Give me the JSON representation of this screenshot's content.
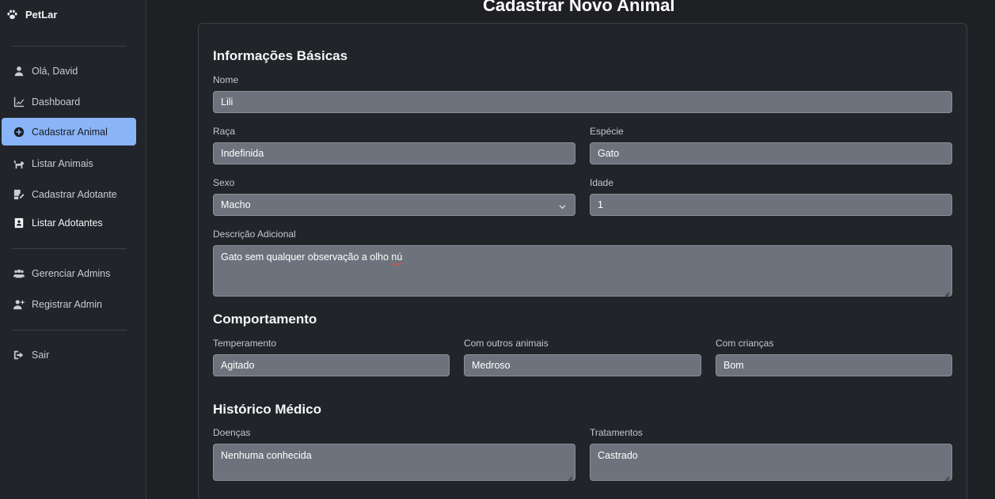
{
  "brand": {
    "name": "PetLar",
    "icon": "paw-icon"
  },
  "sidebar": {
    "items": [
      {
        "label": "Olá, David",
        "icon": "user-icon"
      },
      {
        "label": "Dashboard",
        "icon": "chart-line-icon"
      },
      {
        "label": "Cadastrar Animal",
        "icon": "plus-circle-icon",
        "active": true
      },
      {
        "label": "Listar Animais",
        "icon": "dog-icon"
      },
      {
        "label": "Cadastrar Adotante",
        "icon": "edit-user-icon"
      },
      {
        "label": "Listar Adotantes",
        "icon": "address-book-icon"
      },
      {
        "label": "Gerenciar Admins",
        "icon": "users-icon"
      },
      {
        "label": "Registrar Admin",
        "icon": "user-plus-icon"
      },
      {
        "label": "Sair",
        "icon": "sign-out-icon"
      }
    ]
  },
  "page": {
    "title": "Cadastrar Novo Animal"
  },
  "basic": {
    "title": "Informações Básicas",
    "name": {
      "label": "Nome",
      "value": "Lili"
    },
    "breed": {
      "label": "Raça",
      "value": "Indefinida"
    },
    "species": {
      "label": "Espécie",
      "value": "Gato"
    },
    "sex": {
      "label": "Sexo",
      "value": "Macho"
    },
    "age": {
      "label": "Idade",
      "value": "1"
    },
    "description": {
      "label": "Descrição Adicional",
      "value_main": "Gato sem qualquer observação a olho ",
      "value_flagged": "nú"
    }
  },
  "behavior": {
    "title": "Comportamento",
    "temperament": {
      "label": "Temperamento",
      "value": "Agitado"
    },
    "with_animals": {
      "label": "Com outros animais",
      "value": "Medroso"
    },
    "with_children": {
      "label": "Com crianças",
      "value": "Bom"
    }
  },
  "medical": {
    "title": "Histórico Médico",
    "diseases": {
      "label": "Doenças",
      "value": "Nenhuma conhecida"
    },
    "treatments": {
      "label": "Tratamentos",
      "value": "Castrado"
    }
  },
  "colors": {
    "accent": "#8ab4f8",
    "input_bg": "#6c737c",
    "card_bg": "#212529",
    "page_bg": "#1f2023"
  }
}
